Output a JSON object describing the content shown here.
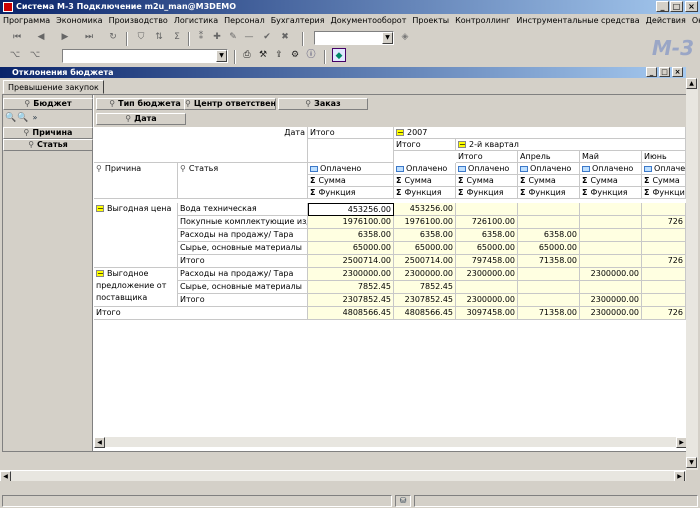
{
  "window": {
    "title": "Система М-3 Подключение m2u_man@M3DEMO"
  },
  "menu": [
    "Программа",
    "Экономика",
    "Производство",
    "Логистика",
    "Персонал",
    "Бухгалтерия",
    "Документооборот",
    "Проекты",
    "Контроллинг",
    "Инструментальные средства",
    "Действия",
    "Окна"
  ],
  "logo": "M-3",
  "child_window": {
    "title": "Отклонения бюджета"
  },
  "tabs": [
    {
      "label": "Превышение закупок"
    }
  ],
  "dimensions": {
    "left_header": "Бюджет",
    "top_fields": [
      "Тип бюджета",
      "Центр ответственнос",
      "Заказ"
    ],
    "date_field": "Дата",
    "row_fields": [
      "Причина",
      "Статья"
    ]
  },
  "grid": {
    "date_label": "Дата",
    "total_label": "Итого",
    "year": "2007",
    "quarter": "2-й квартал",
    "months": [
      "Апрель",
      "Май",
      "Июнь"
    ],
    "row_header_cols": [
      "Причина",
      "Статья"
    ],
    "measure": "Оплачено",
    "sum": "Сумма",
    "func": "Функция",
    "groups": [
      {
        "reason": "Выгодная цена",
        "rows": [
          {
            "item": "Вода техническая",
            "v": [
              "453256.00",
              "453256.00",
              "",
              "",
              "",
              ""
            ]
          },
          {
            "item": "Покупные комплектующие изделия",
            "v": [
              "1976100.00",
              "1976100.00",
              "726100.00",
              "",
              "",
              "726"
            ]
          },
          {
            "item": "Расходы на продажу/ Тара",
            "v": [
              "6358.00",
              "6358.00",
              "6358.00",
              "6358.00",
              "",
              ""
            ]
          },
          {
            "item": "Сырье, основные материалы",
            "v": [
              "65000.00",
              "65000.00",
              "65000.00",
              "65000.00",
              "",
              ""
            ]
          },
          {
            "item": "Итого",
            "v": [
              "2500714.00",
              "2500714.00",
              "797458.00",
              "71358.00",
              "",
              "726"
            ]
          }
        ]
      },
      {
        "reason": "Выгодное предложение от поставщика",
        "rows": [
          {
            "item": "Расходы на продажу/ Тара",
            "v": [
              "2300000.00",
              "2300000.00",
              "2300000.00",
              "",
              "2300000.00",
              ""
            ]
          },
          {
            "item": "Сырье, основные материалы",
            "v": [
              "7852.45",
              "7852.45",
              "",
              "",
              "",
              ""
            ]
          },
          {
            "item": "Итого",
            "v": [
              "2307852.45",
              "2307852.45",
              "2300000.00",
              "",
              "2300000.00",
              ""
            ]
          }
        ]
      }
    ],
    "grand_total": {
      "label": "Итого",
      "v": [
        "4808566.45",
        "4808566.45",
        "3097458.00",
        "71358.00",
        "2300000.00",
        "726"
      ]
    }
  }
}
